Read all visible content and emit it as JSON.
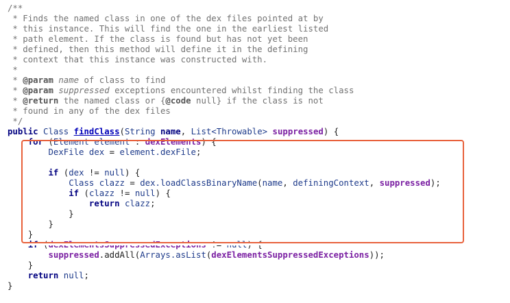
{
  "code": {
    "language": "java",
    "lines": [
      [
        {
          "t": "/**",
          "k": "comment"
        }
      ],
      [
        {
          "t": " * Finds the named class in one of the dex files pointed at by",
          "k": "comment"
        }
      ],
      [
        {
          "t": " * this instance. This will find the one in the earliest listed",
          "k": "comment"
        }
      ],
      [
        {
          "t": " * path element. If the class is found but has not yet been",
          "k": "comment"
        }
      ],
      [
        {
          "t": " * defined, then this method will define it in the defining",
          "k": "comment"
        }
      ],
      [
        {
          "t": " * context that this instance was constructed with.",
          "k": "comment"
        }
      ],
      [
        {
          "t": " *",
          "k": "comment"
        }
      ],
      [
        {
          "t": " * ",
          "k": "comment"
        },
        {
          "t": "@param",
          "k": "tag"
        },
        {
          "t": " ",
          "k": "comment"
        },
        {
          "t": "name",
          "k": "param-name"
        },
        {
          "t": " of class to find",
          "k": "comment"
        }
      ],
      [
        {
          "t": " * ",
          "k": "comment"
        },
        {
          "t": "@param",
          "k": "tag"
        },
        {
          "t": " ",
          "k": "comment"
        },
        {
          "t": "suppressed",
          "k": "param-name"
        },
        {
          "t": " exceptions encountered whilst finding the class",
          "k": "comment"
        }
      ],
      [
        {
          "t": " * ",
          "k": "comment"
        },
        {
          "t": "@return",
          "k": "tag"
        },
        {
          "t": " the named class or {",
          "k": "comment"
        },
        {
          "t": "@code",
          "k": "tag"
        },
        {
          "t": " null} if the class is not",
          "k": "comment"
        }
      ],
      [
        {
          "t": " * found in any of the dex files",
          "k": "comment"
        }
      ],
      [
        {
          "t": " */",
          "k": "comment"
        }
      ],
      [
        {
          "t": "public",
          "k": "keyword"
        },
        {
          "t": " ",
          "k": "plain"
        },
        {
          "t": "Class",
          "k": "type"
        },
        {
          "t": " ",
          "k": "plain"
        },
        {
          "t": "findClass",
          "k": "method"
        },
        {
          "t": "(",
          "k": "plain"
        },
        {
          "t": "String",
          "k": "type"
        },
        {
          "t": " ",
          "k": "plain"
        },
        {
          "t": "name",
          "k": "keyword"
        },
        {
          "t": ", ",
          "k": "plain"
        },
        {
          "t": "List<Throwable>",
          "k": "type"
        },
        {
          "t": " ",
          "k": "plain"
        },
        {
          "t": "suppressed",
          "k": "field"
        },
        {
          "t": ") {",
          "k": "plain"
        }
      ],
      [
        {
          "t": "    ",
          "k": "plain"
        },
        {
          "t": "for",
          "k": "keyword"
        },
        {
          "t": " (",
          "k": "plain"
        },
        {
          "t": "Element element",
          "k": "ident"
        },
        {
          "t": " : ",
          "k": "plain"
        },
        {
          "t": "dexElements",
          "k": "field"
        },
        {
          "t": ") {",
          "k": "plain"
        }
      ],
      [
        {
          "t": "        ",
          "k": "plain"
        },
        {
          "t": "DexFile dex",
          "k": "ident"
        },
        {
          "t": " = ",
          "k": "plain"
        },
        {
          "t": "element.dexFile",
          "k": "ident"
        },
        {
          "t": ";",
          "k": "plain"
        }
      ],
      [
        {
          "t": "",
          "k": "plain"
        }
      ],
      [
        {
          "t": "        ",
          "k": "plain"
        },
        {
          "t": "if",
          "k": "keyword"
        },
        {
          "t": " (",
          "k": "plain"
        },
        {
          "t": "dex",
          "k": "ident"
        },
        {
          "t": " != ",
          "k": "plain"
        },
        {
          "t": "null",
          "k": "ident"
        },
        {
          "t": ") {",
          "k": "plain"
        }
      ],
      [
        {
          "t": "            ",
          "k": "plain"
        },
        {
          "t": "Class clazz",
          "k": "ident"
        },
        {
          "t": " = ",
          "k": "plain"
        },
        {
          "t": "dex.loadClassBinaryName",
          "k": "ident"
        },
        {
          "t": "(",
          "k": "plain"
        },
        {
          "t": "name",
          "k": "ident"
        },
        {
          "t": ", ",
          "k": "plain"
        },
        {
          "t": "definingContext",
          "k": "ident"
        },
        {
          "t": ", ",
          "k": "plain"
        },
        {
          "t": "suppressed",
          "k": "field"
        },
        {
          "t": ");",
          "k": "plain"
        }
      ],
      [
        {
          "t": "            ",
          "k": "plain"
        },
        {
          "t": "if",
          "k": "keyword"
        },
        {
          "t": " (",
          "k": "plain"
        },
        {
          "t": "clazz",
          "k": "ident"
        },
        {
          "t": " != ",
          "k": "plain"
        },
        {
          "t": "null",
          "k": "ident"
        },
        {
          "t": ") {",
          "k": "plain"
        }
      ],
      [
        {
          "t": "                ",
          "k": "plain"
        },
        {
          "t": "return",
          "k": "keyword"
        },
        {
          "t": " ",
          "k": "plain"
        },
        {
          "t": "clazz",
          "k": "ident"
        },
        {
          "t": ";",
          "k": "plain"
        }
      ],
      [
        {
          "t": "            }",
          "k": "plain"
        }
      ],
      [
        {
          "t": "        }",
          "k": "plain"
        }
      ],
      [
        {
          "t": "    }",
          "k": "plain"
        }
      ],
      [
        {
          "t": "    ",
          "k": "plain"
        },
        {
          "t": "if",
          "k": "keyword"
        },
        {
          "t": " (",
          "k": "plain"
        },
        {
          "t": "dexElementsSuppressedExceptions",
          "k": "field"
        },
        {
          "t": " != ",
          "k": "plain"
        },
        {
          "t": "null",
          "k": "ident"
        },
        {
          "t": ") {",
          "k": "plain"
        }
      ],
      [
        {
          "t": "        ",
          "k": "plain"
        },
        {
          "t": "suppressed",
          "k": "field"
        },
        {
          "t": ".addAll(",
          "k": "plain"
        },
        {
          "t": "Arrays.asList",
          "k": "ident"
        },
        {
          "t": "(",
          "k": "plain"
        },
        {
          "t": "dexElementsSuppressedExceptions",
          "k": "field"
        },
        {
          "t": "));",
          "k": "plain"
        }
      ],
      [
        {
          "t": "    }",
          "k": "plain"
        }
      ],
      [
        {
          "t": "    ",
          "k": "plain"
        },
        {
          "t": "return",
          "k": "keyword"
        },
        {
          "t": " ",
          "k": "plain"
        },
        {
          "t": "null",
          "k": "ident"
        },
        {
          "t": ";",
          "k": "plain"
        }
      ],
      [
        {
          "t": "}",
          "k": "plain"
        }
      ]
    ]
  },
  "annotation": {
    "color": "#e8603a"
  }
}
